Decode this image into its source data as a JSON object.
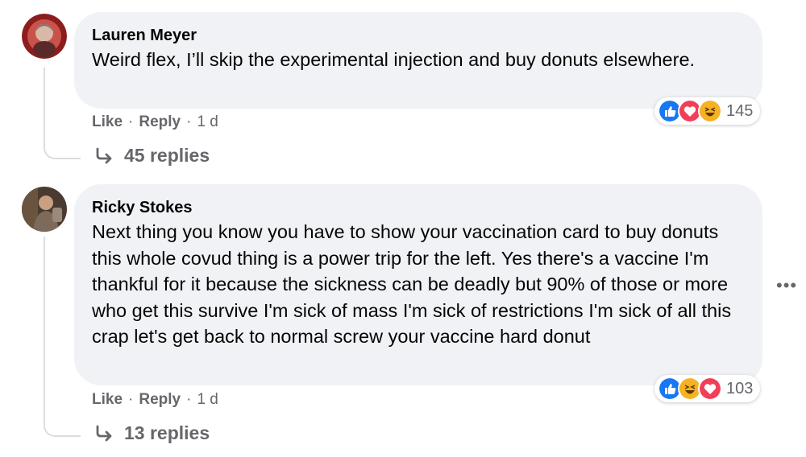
{
  "comments": [
    {
      "author": "Lauren Meyer",
      "text": "Weird flex, I’ll skip the experimental injection and buy donuts elsewhere.",
      "reactions": {
        "icons": [
          "like-icon",
          "love-icon",
          "haha-icon"
        ],
        "count": "145"
      },
      "actions": {
        "like": "Like",
        "sep1": "·",
        "reply": "Reply",
        "sep2": "·",
        "time": "1 d"
      },
      "replies": "45 replies"
    },
    {
      "author": "Ricky Stokes",
      "text": "Next thing you know you have to show your vaccination card to buy donuts this whole covud thing is a power trip for the left. Yes there's a vaccine I'm thankful for it because the sickness can be deadly but 90% of those or more who get this survive I'm sick of mass I'm sick of restrictions I'm sick of all this crap let's get back to normal screw your vaccine hard donut",
      "reactions": {
        "icons": [
          "like-icon",
          "haha-icon",
          "love-icon"
        ],
        "count": "103"
      },
      "actions": {
        "like": "Like",
        "sep1": "·",
        "reply": "Reply",
        "sep2": "·",
        "time": "1 d"
      },
      "replies": "13 replies"
    }
  ],
  "more_options": "•••",
  "colors": {
    "bubble": "#f0f2f5",
    "secondary_text": "#65676b",
    "like_blue": "#1877f2",
    "love_red": "#f33e58",
    "haha_yellow": "#f7b125"
  }
}
